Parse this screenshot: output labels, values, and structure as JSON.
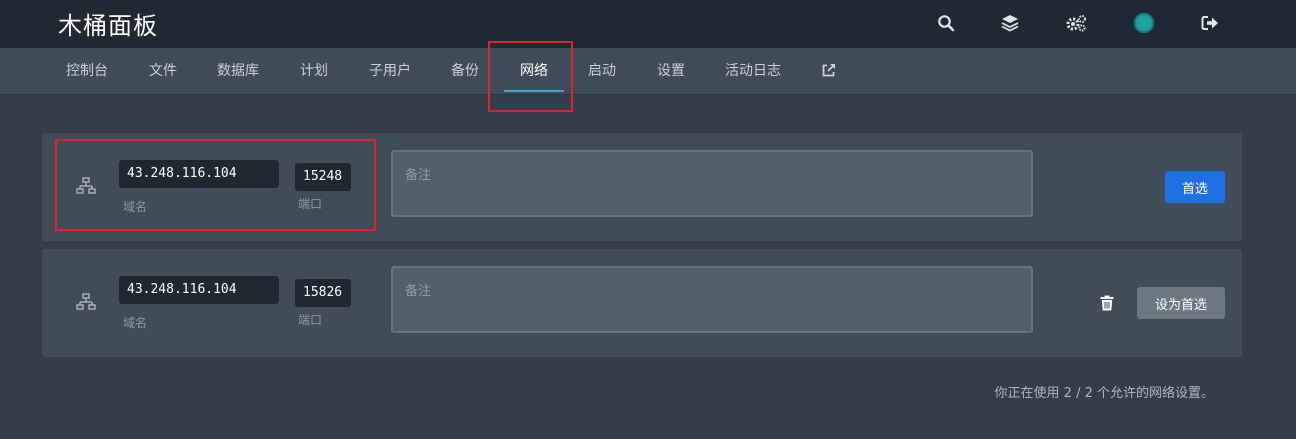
{
  "header": {
    "title": "木桶面板",
    "icons": [
      "search-icon",
      "layers-icon",
      "cogs-icon",
      "avatar",
      "logout-icon"
    ]
  },
  "tabs": [
    {
      "label": "控制台"
    },
    {
      "label": "文件"
    },
    {
      "label": "数据库"
    },
    {
      "label": "计划"
    },
    {
      "label": "子用户"
    },
    {
      "label": "备份"
    },
    {
      "label": "网络",
      "active": true
    },
    {
      "label": "启动"
    },
    {
      "label": "设置"
    },
    {
      "label": "活动日志"
    },
    {
      "label": "",
      "icon": "external-link-icon"
    }
  ],
  "allocations": [
    {
      "host": "43.248.116.104",
      "host_label": "域名",
      "port": "15248",
      "port_label": "端口",
      "note_placeholder": "备注",
      "action_label": "首选",
      "primary": true
    },
    {
      "host": "43.248.116.104",
      "host_label": "域名",
      "port": "15826",
      "port_label": "端口",
      "note_placeholder": "备注",
      "action_label": "设为首选",
      "primary": false
    }
  ],
  "footer": {
    "usage_text": "你正在使用 2 / 2 个允许的网络设置。"
  },
  "colors": {
    "accent": "#1f6fe5",
    "highlight": "#e0222a",
    "tab_underline": "#3ea0d8"
  }
}
